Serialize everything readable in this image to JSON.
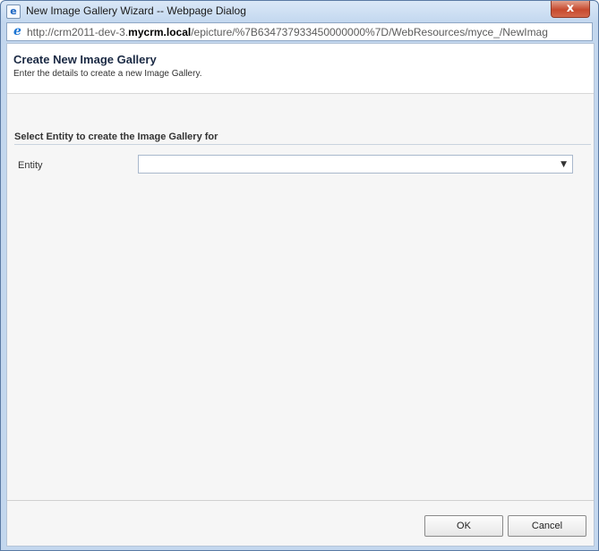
{
  "window": {
    "title": "New Image Gallery Wizard -- Webpage Dialog",
    "close_glyph": "x"
  },
  "address": {
    "url_prefix": "http://crm2011-dev-3.",
    "url_domain": "mycrm.local",
    "url_suffix": "/epicture/%7B634737933450000000%7D/WebResources/myce_/NewImag"
  },
  "header": {
    "title": "Create New Image Gallery",
    "subtitle": "Enter the details to create a new Image Gallery."
  },
  "section": {
    "title": "Select Entity to create the Image Gallery for",
    "entity_label": "Entity",
    "entity_value": ""
  },
  "footer": {
    "ok_label": "OK",
    "cancel_label": "Cancel"
  },
  "colors": {
    "frame": "#c3d7ee",
    "close_button": "#c74a2f"
  },
  "icons": {
    "page_icon": "ie-page-icon",
    "address_icon": "ie-logo-icon",
    "dropdown": "chevron-down-icon"
  }
}
